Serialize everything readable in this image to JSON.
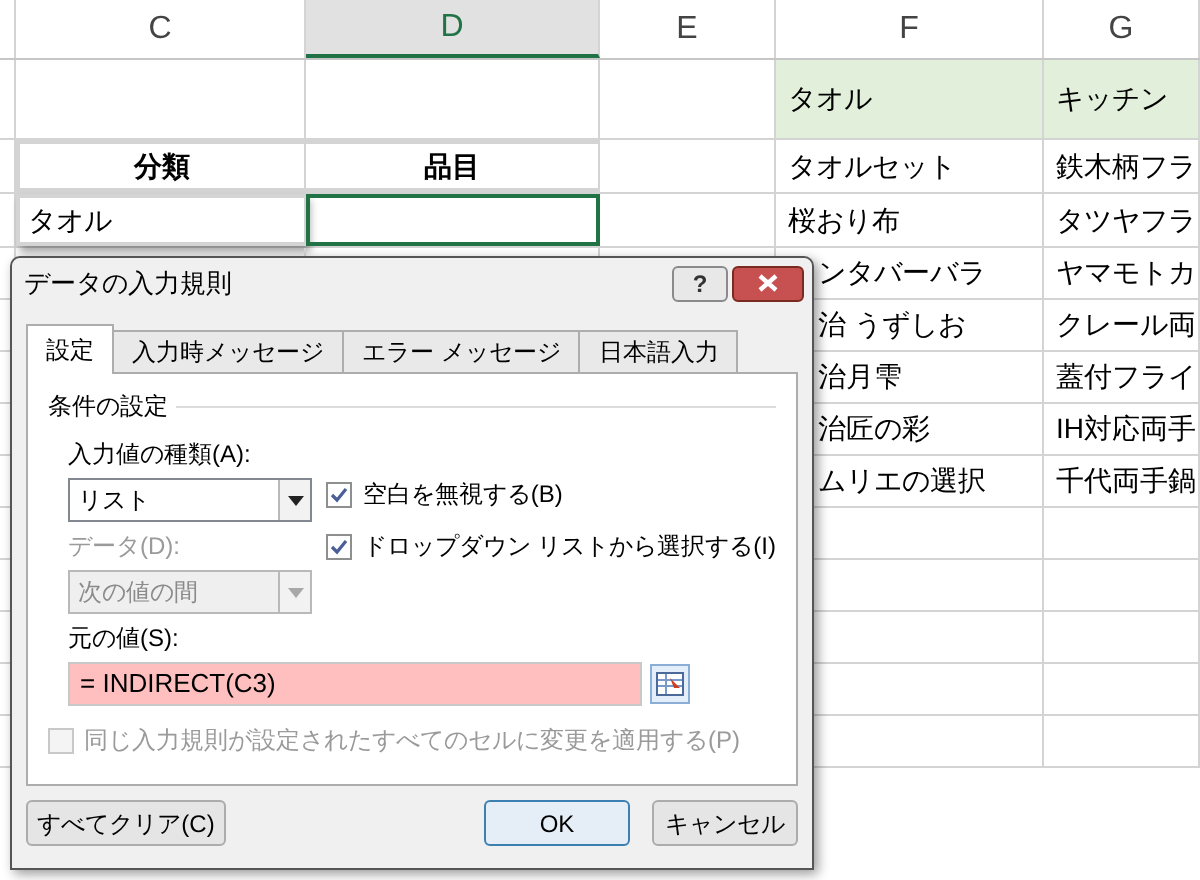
{
  "sheet": {
    "columns": [
      {
        "label": "C",
        "selected": false
      },
      {
        "label": "D",
        "selected": true
      },
      {
        "label": "E",
        "selected": false
      },
      {
        "label": "F",
        "selected": false
      },
      {
        "label": "G",
        "selected": false
      }
    ],
    "table_header": [
      "分類",
      "品目"
    ],
    "category_cell": "タオル",
    "list_header": [
      "タオル",
      "キッチン"
    ],
    "list_rows": [
      [
        "タオルセット",
        "鉄木柄フラ"
      ],
      [
        "桜おり布",
        "タツヤフラ"
      ],
      [
        "ンタバーバラ",
        "ヤマモトカ"
      ],
      [
        "治 うずしお",
        "クレール両"
      ],
      [
        "治月雫",
        "蓋付フライ"
      ],
      [
        "治匠の彩",
        "IH対応両手"
      ],
      [
        "ムリエの選択",
        "千代両手鍋"
      ]
    ]
  },
  "dialog": {
    "title": "データの入力規則",
    "help": "?",
    "tabs": [
      {
        "label": "設定",
        "selected": true
      },
      {
        "label": "入力時メッセージ",
        "selected": false
      },
      {
        "label": "エラー メッセージ",
        "selected": false
      },
      {
        "label": "日本語入力",
        "selected": false
      }
    ],
    "group_title": "条件の設定",
    "allow": {
      "label": "入力値の種類(A):",
      "value": "リスト",
      "disabled": false
    },
    "data": {
      "label": "データ(D):",
      "value": "次の値の間",
      "disabled": true
    },
    "checkboxes": [
      {
        "label": "空白を無視する(B)",
        "checked": true,
        "disabled": false
      },
      {
        "label": "ドロップダウン リストから選択する(I)",
        "checked": true,
        "disabled": false
      }
    ],
    "source": {
      "label": "元の値(S):",
      "value": "= INDIRECT(C3)"
    },
    "apply_all": {
      "label": "同じ入力規則が設定されたすべてのセルに変更を適用する(P)",
      "checked": false,
      "disabled": true
    },
    "buttons": {
      "clear": "すべてクリア(C)",
      "ok": "OK",
      "cancel": "キャンセル"
    }
  }
}
